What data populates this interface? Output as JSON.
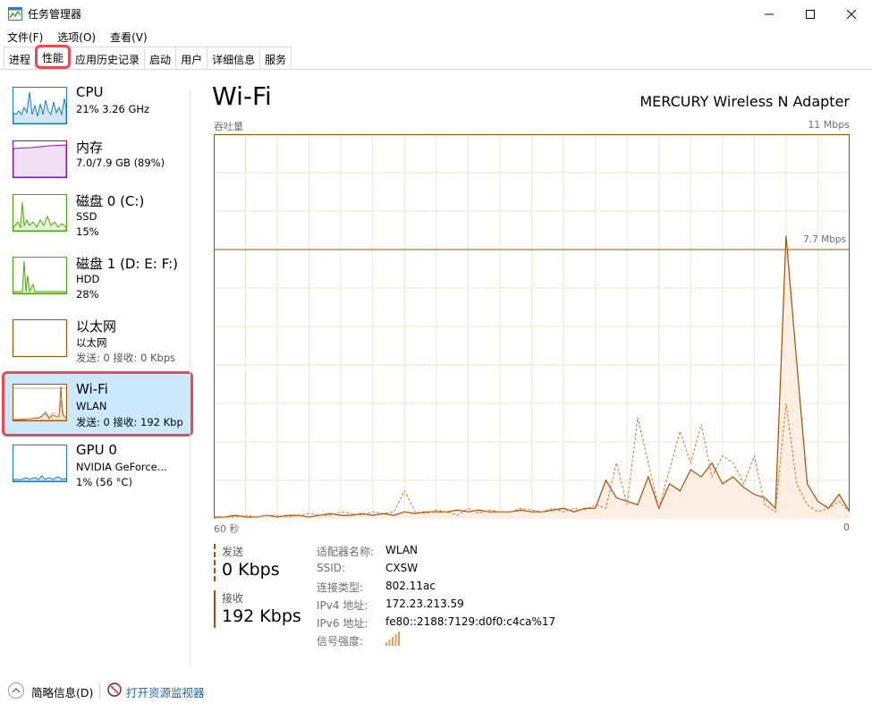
{
  "window": {
    "title": "任务管理器",
    "minimize_icon": "minimize-icon",
    "maximize_icon": "maximize-icon",
    "close_icon": "close-icon"
  },
  "menubar": [
    {
      "label": "文件(F)"
    },
    {
      "label": "选项(O)"
    },
    {
      "label": "查看(V)"
    }
  ],
  "tabs": [
    {
      "label": "进程",
      "active": false
    },
    {
      "label": "性能",
      "active": true
    },
    {
      "label": "应用历史记录",
      "active": false
    },
    {
      "label": "启动",
      "active": false
    },
    {
      "label": "用户",
      "active": false
    },
    {
      "label": "详细信息",
      "active": false
    },
    {
      "label": "服务",
      "active": false
    }
  ],
  "sidebar": {
    "items": [
      {
        "name": "CPU",
        "l2": "21%  3.26 GHz",
        "l3": "",
        "color": "#1b7cc1"
      },
      {
        "name": "内存",
        "l2": "7.0/7.9 GB (89%)",
        "l3": "",
        "color": "#8b12ae"
      },
      {
        "name": "磁盘 0 (C:)",
        "l2": "SSD",
        "l3": "15%",
        "color": "#4da60c"
      },
      {
        "name": "磁盘 1 (D: E: F:)",
        "l2": "HDD",
        "l3": "28%",
        "color": "#4da60c"
      },
      {
        "name": "以太网",
        "l2": "以太网",
        "l3": "发送: 0  接收: 0 Kbps",
        "color": "#a74f01"
      },
      {
        "name": "Wi-Fi",
        "l2": "WLAN",
        "l3": "发送: 0  接收: 192 Kbp",
        "color": "#a74f01",
        "selected": true
      },
      {
        "name": "GPU 0",
        "l2": "NVIDIA GeForce...",
        "l3": "1% (56 °C)",
        "color": "#1b7cc1"
      }
    ]
  },
  "main": {
    "title": "Wi-Fi",
    "adapter": "MERCURY Wireless N Adapter",
    "throughput_label": "吞吐量",
    "scale_max": "11 Mbps",
    "peak_label": "7.7 Mbps",
    "x_left": "60 秒",
    "x_right": "0",
    "accent": "#a74f01",
    "send_label": "发送",
    "send_value": "0 Kbps",
    "recv_label": "接收",
    "recv_value": "192 Kbps",
    "details": [
      {
        "k": "适配器名称:",
        "v": "WLAN"
      },
      {
        "k": "SSID:",
        "v": "CXSW"
      },
      {
        "k": "连接类型:",
        "v": "802.11ac"
      },
      {
        "k": "IPv4 地址:",
        "v": "172.23.213.59"
      },
      {
        "k": "IPv6 地址:",
        "v": "fe80::2188:7129:d0f0:c4ca%17"
      },
      {
        "k": "信号强度:",
        "v": "",
        "icon": "signal-strength-icon"
      }
    ]
  },
  "footer": {
    "brief_label": "简略信息(D)",
    "monitor_link": "打开资源监视器"
  },
  "chart_data": {
    "type": "area",
    "title": "",
    "xlabel": "",
    "ylabel": "吞吐量",
    "x_range_seconds": [
      60,
      0
    ],
    "ylim_mbps": [
      0,
      11
    ],
    "reference_line_mbps": 7.7,
    "grid": true,
    "series": [
      {
        "name": "接收",
        "style": "solid",
        "values_mbps": [
          0.05,
          0.05,
          0.1,
          0.05,
          0.05,
          0.1,
          0.05,
          0.1,
          0.1,
          0.05,
          0.1,
          0.15,
          0.1,
          0.1,
          0.15,
          0.1,
          0.15,
          0.1,
          0.2,
          0.15,
          0.2,
          0.2,
          0.2,
          0.25,
          0.2,
          0.25,
          0.2,
          0.2,
          0.2,
          0.25,
          0.2,
          0.2,
          0.25,
          0.3,
          0.2,
          0.3,
          0.3,
          1.1,
          0.6,
          0.5,
          0.4,
          1.2,
          0.3,
          1.0,
          0.8,
          1.4,
          1.2,
          1.6,
          1.0,
          1.2,
          0.9,
          0.7,
          0.6,
          0.3,
          8.1,
          4.5,
          1.0,
          0.5,
          0.3,
          0.7,
          0.2
        ]
      },
      {
        "name": "发送",
        "style": "dashed",
        "values_mbps": [
          0.02,
          0.05,
          0.05,
          0.1,
          0.05,
          0.1,
          0.1,
          0.05,
          0.1,
          0.15,
          0.1,
          0.1,
          0.2,
          0.15,
          0.1,
          0.2,
          0.15,
          0.2,
          0.8,
          0.2,
          0.15,
          0.25,
          0.2,
          0.1,
          0.3,
          0.15,
          0.25,
          0.2,
          0.2,
          0.3,
          0.25,
          0.2,
          0.3,
          0.2,
          0.3,
          0.25,
          0.4,
          0.3,
          1.6,
          0.4,
          2.9,
          1.6,
          0.3,
          1.4,
          2.5,
          1.6,
          2.7,
          1.2,
          1.8,
          1.6,
          1.0,
          1.8,
          0.4,
          0.2,
          3.3,
          1.0,
          0.4,
          0.2,
          0.3,
          0.5,
          0.2
        ]
      }
    ]
  }
}
